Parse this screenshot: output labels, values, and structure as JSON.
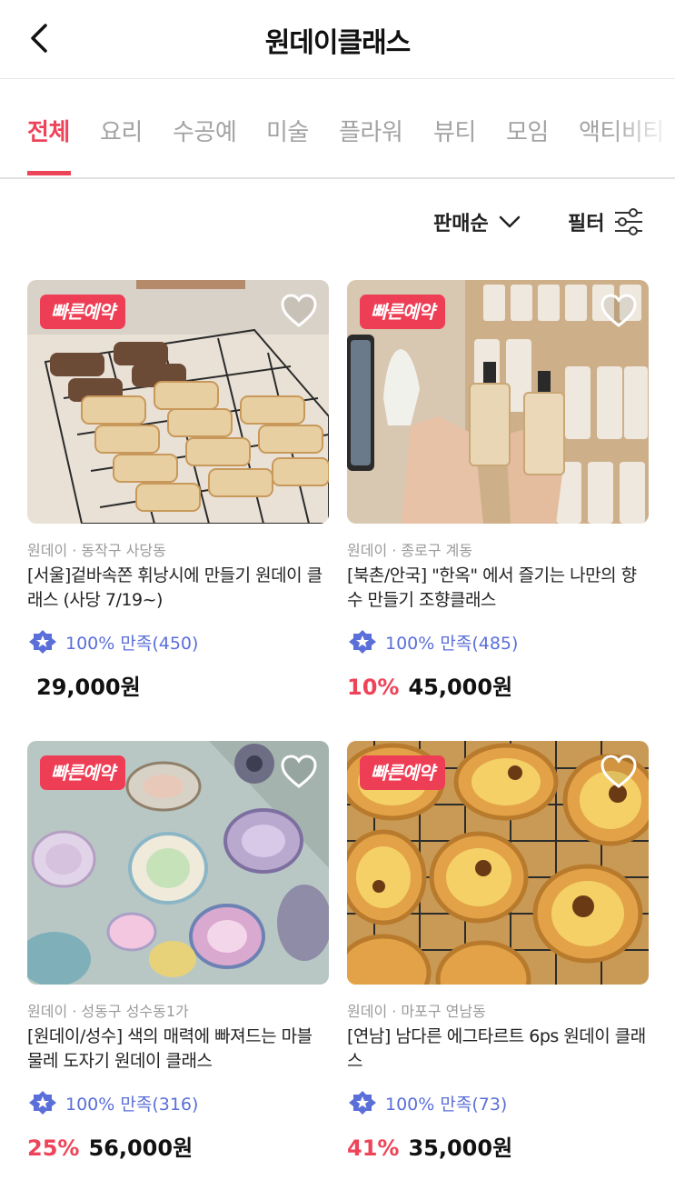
{
  "header": {
    "title": "원데이클래스",
    "back_icon": "chevron-left-icon"
  },
  "tabs": [
    "전체",
    "요리",
    "수공예",
    "미술",
    "플라워",
    "뷰티",
    "모임",
    "액티비티"
  ],
  "active_tab": "전체",
  "sort": {
    "label": "판매순",
    "icon": "chevron-down-icon"
  },
  "filter": {
    "label": "필터",
    "icon": "sliders-icon"
  },
  "colors": {
    "accent": "#ee4459",
    "badge": "#ee3e55",
    "rating": "#5b6fd8"
  },
  "products": [
    {
      "badge": "빠른예약",
      "location": "원데이 · 동작구 사당동",
      "name": "[서울]겉바속쫀 휘낭시에 만들기 원데이 클래스 (사당 7/19~)",
      "rating": "100% 만족(450)",
      "discount": "",
      "price": "29,000원"
    },
    {
      "badge": "빠른예약",
      "location": "원데이 · 종로구 계동",
      "name": "[북촌/안국] \"한옥\" 에서 즐기는 나만의 향수 만들기 조향클래스",
      "rating": "100% 만족(485)",
      "discount": "10%",
      "price": "45,000원"
    },
    {
      "badge": "빠른예약",
      "location": "원데이 · 성동구 성수동1가",
      "name": "[원데이/성수] 색의 매력에 빠져드는 마블 물레 도자기 원데이 클래스",
      "rating": "100% 만족(316)",
      "discount": "25%",
      "price": "56,000원"
    },
    {
      "badge": "빠른예약",
      "location": "원데이 · 마포구 연남동",
      "name": "[연남] 남다른 에그타르트 6ps 원데이 클래스",
      "rating": "100% 만족(73)",
      "discount": "41%",
      "price": "35,000원"
    }
  ]
}
